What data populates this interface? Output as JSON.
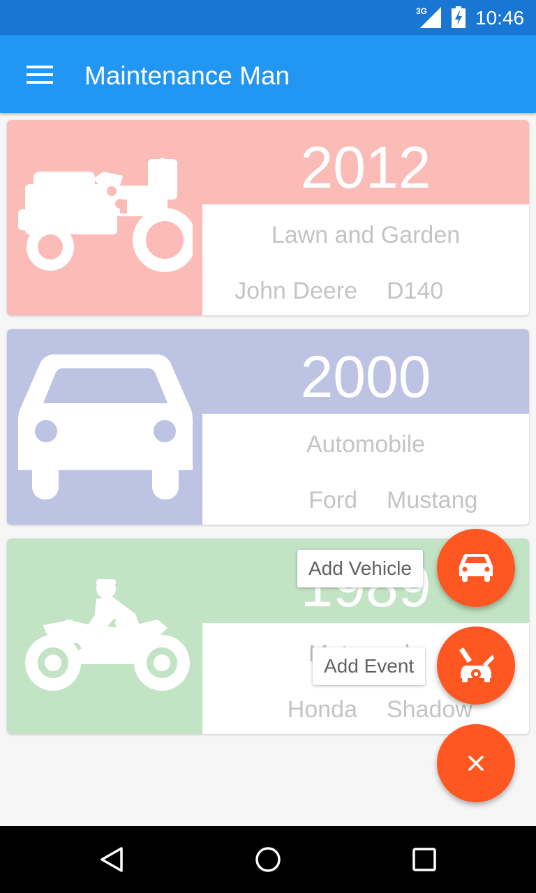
{
  "status_bar": {
    "network": "3G",
    "time": "10:46"
  },
  "app_bar": {
    "title": "Maintenance Man"
  },
  "vehicles": [
    {
      "year": "2012",
      "category": "Lawn and Garden",
      "make": "John Deere",
      "model": "D140",
      "icon": "tractor-icon",
      "color": "#fbbcb8"
    },
    {
      "year": "2000",
      "category": "Automobile",
      "make": "Ford",
      "model": "Mustang",
      "icon": "car-icon",
      "color": "#bcc3e3"
    },
    {
      "year": "1989",
      "category": "Motorcycle",
      "make": "Honda",
      "model": "Shadow",
      "icon": "motorcycle-icon",
      "color": "#c2e3c4"
    }
  ],
  "fab_menu": {
    "add_vehicle_label": "Add Vehicle",
    "add_event_label": "Add Event",
    "close_icon": "close-icon",
    "accent": "#ff5722"
  }
}
